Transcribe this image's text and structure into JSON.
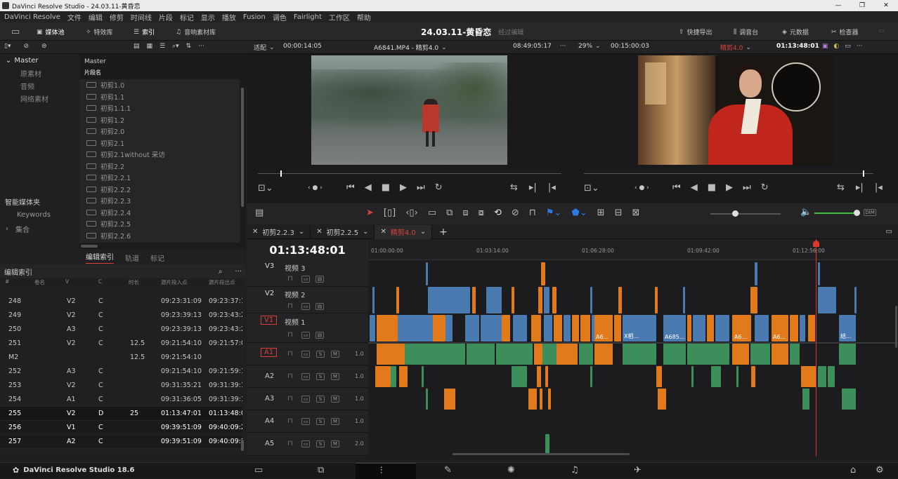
{
  "window": {
    "title": "DaVinci Resolve Studio - 24.03.11-黄昏恋",
    "min": "—",
    "max": "❐",
    "close": "✕"
  },
  "menu": [
    "DaVinci Resolve",
    "文件",
    "编辑",
    "修剪",
    "时间线",
    "片段",
    "标记",
    "显示",
    "播放",
    "Fusion",
    "调色",
    "Fairlight",
    "工作区",
    "帮助"
  ],
  "toolbar": {
    "media_pool": "媒体池",
    "effects": "特效库",
    "index": "索引",
    "sound_library": "音响素材库",
    "project_title": "24.03.11-黄昏恋",
    "project_status": "经过编辑",
    "quick_export": "快捷导出",
    "mixer": "调音台",
    "metadata": "元数据",
    "inspector": "检查器"
  },
  "viewer": {
    "fit": "适配",
    "source_tc": "00:00:14:05",
    "source_clip": "A6841.MP4 - 精剪4.0",
    "source_dur": "08:49:05:17",
    "zoom": "29%",
    "timeline_tc_left": "00:15:00:03",
    "timeline_name": "精剪4.0",
    "timeline_tc": "01:13:48:01"
  },
  "media_pool": {
    "root": "Master",
    "items": [
      "原素材",
      "音频",
      "网络素材"
    ],
    "smart_bins": "智能媒体夹",
    "keywords": "Keywords",
    "collections": "集合",
    "column_header": "片段名",
    "clips": [
      "初剪1.0",
      "初剪1.1",
      "初剪1.1.1",
      "初剪1.2",
      "初剪2.0",
      "初剪2.1",
      "初剪2.1without 采访",
      "初剪2.2",
      "初剪2.2.1",
      "初剪2.2.2",
      "初剪2.2.3",
      "初剪2.2.4",
      "初剪2.2.5",
      "初剪2.2.6"
    ]
  },
  "index_panel": {
    "tabs": [
      "编辑索引",
      "轨道",
      "标记"
    ],
    "title": "编辑索引",
    "columns": [
      "#",
      "卷名",
      "V",
      "C",
      "时长",
      "源片段入点",
      "源片段出点"
    ],
    "rows": [
      [
        "248",
        "",
        "V2",
        "C",
        "",
        "09:23:31:09",
        "09:23:37:1"
      ],
      [
        "249",
        "",
        "V2",
        "C",
        "",
        "09:23:39:13",
        "09:23:43:2"
      ],
      [
        "250",
        "",
        "A3",
        "C",
        "",
        "09:23:39:13",
        "09:23:43:2"
      ],
      [
        "251",
        "",
        "V2",
        "C",
        "12.5",
        "09:21:54:10",
        "09:21:57:0"
      ],
      [
        "M2",
        "",
        "",
        "",
        "12.5",
        "09:21:54:10",
        ""
      ],
      [
        "252",
        "",
        "A3",
        "C",
        "",
        "09:21:54:10",
        "09:21:59:1"
      ],
      [
        "253",
        "",
        "V2",
        "C",
        "",
        "09:31:35:21",
        "09:31:39:1"
      ],
      [
        "254",
        "",
        "A1",
        "C",
        "",
        "09:31:36:05",
        "09:31:39:1"
      ],
      [
        "255",
        "",
        "V2",
        "D",
        "25",
        "01:13:47:01",
        "01:13:48:0"
      ],
      [
        "256",
        "",
        "V1",
        "C",
        "",
        "09:39:51:09",
        "09:40:09:2"
      ],
      [
        "257",
        "",
        "A2",
        "C",
        "",
        "09:39:51:09",
        "09:40:09:2"
      ]
    ]
  },
  "timeline": {
    "tabs": [
      "初剪2.2.3",
      "初剪2.2.5",
      "精剪4.0"
    ],
    "timecode": "01:13:48:01",
    "ruler": [
      "01:00:00:00",
      "01:03:14:00",
      "01:06:28:00",
      "01:09:42:00",
      "01:12:56:00"
    ],
    "video_tracks": [
      {
        "id": "V3",
        "name": "视频 3"
      },
      {
        "id": "V2",
        "name": "视频 2"
      },
      {
        "id": "V1",
        "name": "视频 1"
      }
    ],
    "audio_tracks": [
      {
        "id": "A1",
        "level": "1.0"
      },
      {
        "id": "A2",
        "level": "1.0"
      },
      {
        "id": "A3",
        "level": "1.0"
      },
      {
        "id": "A4",
        "level": "1.0"
      },
      {
        "id": "A5",
        "level": "2.0"
      }
    ],
    "clip_labels": [
      "A6...",
      "X相...",
      "A685...",
      "A6...",
      "A6...",
      "结..."
    ]
  },
  "footer": {
    "app": "DaVinci Resolve Studio 18.6"
  },
  "colors": {
    "orange": "#e07a1a",
    "blue": "#4a7bb0",
    "green": "#3c8f5a",
    "playhead": "#e0362c",
    "accent_red": "#d8413a"
  }
}
